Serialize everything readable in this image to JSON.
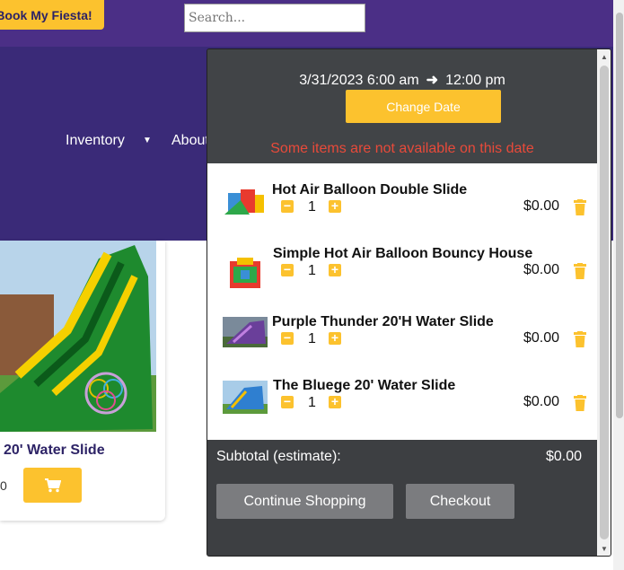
{
  "topbar": {
    "book_label": "Book My Fiesta!",
    "search_placeholder": "Search..."
  },
  "nav": {
    "inventory_label": "Inventory",
    "about_label": "About"
  },
  "product": {
    "name": "20' Water Slide",
    "price": "0"
  },
  "cart": {
    "start_date": "3/31/2023 6:00 am",
    "end_time": "12:00 pm",
    "change_date_label": "Change Date",
    "unavailable_notice": "Some items are not available on this date",
    "items": [
      {
        "name": "Hot Air Balloon Double Slide",
        "qty": "1",
        "price": "$0.00",
        "thumb_color": "#3a8fd6"
      },
      {
        "name": "Simple Hot Air Balloon Bouncy House",
        "qty": "1",
        "price": "$0.00",
        "thumb_color": "#e83a2e"
      },
      {
        "name": "Purple Thunder 20'H Water Slide",
        "qty": "1",
        "price": "$0.00",
        "thumb_color": "#6a3f9a"
      },
      {
        "name": "The Bluege 20' Water Slide",
        "qty": "1",
        "price": "$0.00",
        "thumb_color": "#2f7fd0"
      }
    ],
    "subtotal_label": "Subtotal (estimate):",
    "subtotal_value": "$0.00",
    "continue_label": "Continue Shopping",
    "checkout_label": "Checkout"
  },
  "colors": {
    "accent": "#fcc22e",
    "brand_purple": "#4b2f86",
    "cart_bg": "#3d3f42",
    "warning": "#e84a3a"
  }
}
